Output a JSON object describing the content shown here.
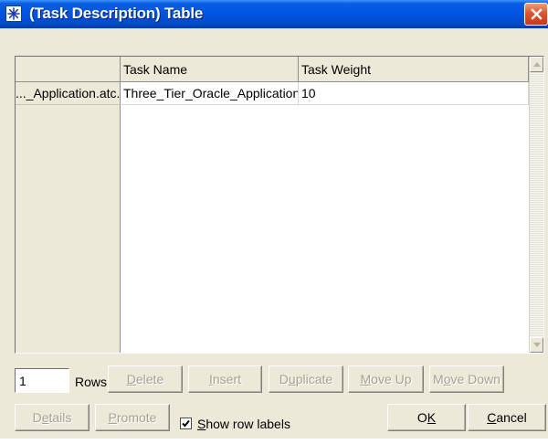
{
  "window": {
    "title": "(Task Description) Table"
  },
  "table": {
    "columns": [
      "Task Name",
      "Task Weight"
    ],
    "rows": [
      {
        "label": "..._Application.atc.m",
        "task_name": "Three_Tier_Oracle_Application.at...",
        "task_weight": "10"
      }
    ]
  },
  "controls": {
    "rows_value": "1",
    "rows_label": "Rows",
    "delete": {
      "mn": "D",
      "rest": "elete"
    },
    "insert": {
      "mn": "I",
      "rest": "nsert"
    },
    "duplicate": {
      "pre": "D",
      "mn": "u",
      "rest": "plicate"
    },
    "move_up": {
      "mn": "M",
      "rest": "ove Up"
    },
    "move_down": {
      "pre": "M",
      "mn": "o",
      "rest": "ve Down"
    },
    "details": {
      "pre": "D",
      "mn": "e",
      "rest": "tails"
    },
    "promote": {
      "mn": "P",
      "rest": "romote"
    },
    "show_row_labels": {
      "mn": "S",
      "rest": "how row labels",
      "checked": true
    },
    "ok": {
      "pre": "O",
      "mn": "K",
      "rest": ""
    },
    "cancel": {
      "mn": "C",
      "rest": "ancel"
    }
  },
  "colors": {
    "titlebar": "#0055e5",
    "close": "#e0542e",
    "face": "#ece9d8"
  },
  "icons": {
    "app": "table-window-icon",
    "close": "close-icon"
  }
}
